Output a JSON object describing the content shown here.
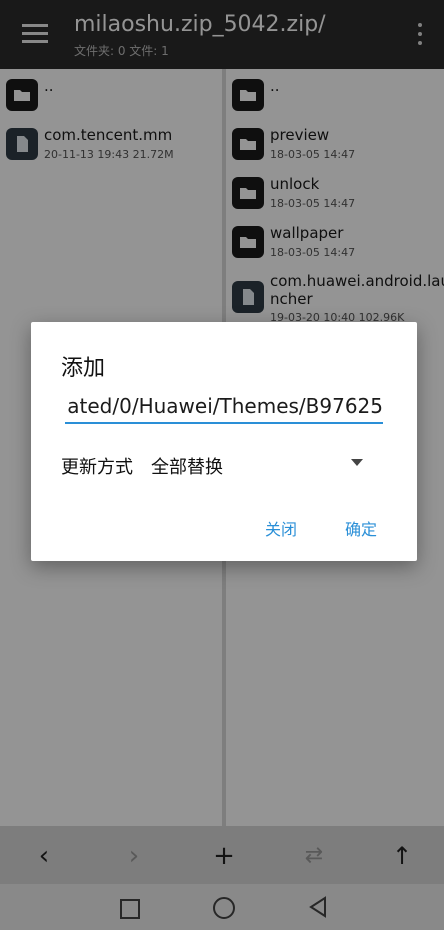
{
  "header": {
    "title": "milaoshu.zip_5042.zip/",
    "subtitle": "文件夹: 0  文件: 1"
  },
  "left_pane": {
    "items": [
      {
        "name": "..",
        "meta": "",
        "type": "folder"
      },
      {
        "name": "com.tencent.mm",
        "meta": "20-11-13 19:43  21.72M",
        "type": "file"
      }
    ]
  },
  "right_pane": {
    "items": [
      {
        "name": "..",
        "meta": "",
        "type": "folder"
      },
      {
        "name": "preview",
        "meta": "18-03-05 14:47",
        "type": "folder"
      },
      {
        "name": "unlock",
        "meta": "18-03-05 14:47",
        "type": "folder"
      },
      {
        "name": "wallpaper",
        "meta": "18-03-05 14:47",
        "type": "folder"
      },
      {
        "name": "com.huawei.android.launcher",
        "name_line1": "com.huawei.android.lau",
        "name_line2": "ncher",
        "meta": "19-03-20 10:40  102.96K",
        "type": "file"
      }
    ]
  },
  "dialog": {
    "title": "添加",
    "path_value": "ated/0/Huawei/Themes/B97625",
    "mode_label": "更新方式",
    "mode_value": "全部替换",
    "close_label": "关闭",
    "ok_label": "确定"
  },
  "toolbar": {
    "back_icon": "‹",
    "forward_icon": "›",
    "add_icon": "+",
    "swap_icon": "⇄",
    "up_icon": "↑"
  },
  "colors": {
    "accent": "#2a8fd7",
    "topbar": "#2b2b2b"
  }
}
